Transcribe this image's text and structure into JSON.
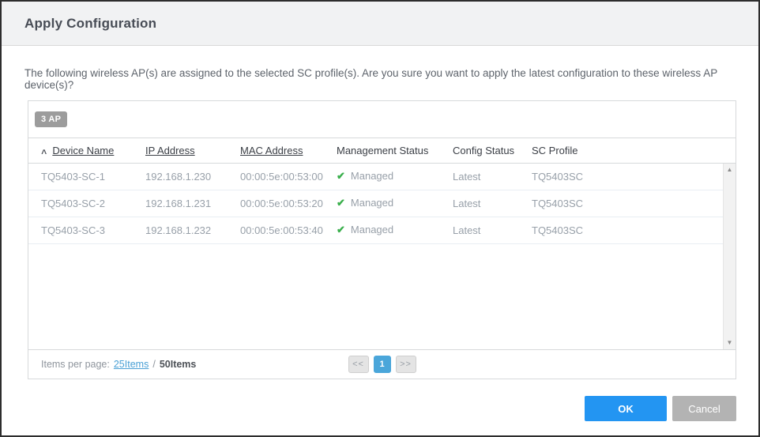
{
  "dialog": {
    "title": "Apply Configuration",
    "description": "The following wireless AP(s) are assigned to the selected SC profile(s). Are you sure you want to apply the latest configuration to these wireless AP device(s)?"
  },
  "icons": {
    "sort_asc": "∧",
    "check": "✔",
    "scroll_up": "▲",
    "scroll_down": "▼"
  },
  "table": {
    "count_badge": "3 AP",
    "columns": [
      {
        "label": "Device Name",
        "sortable": true,
        "sorted": "asc"
      },
      {
        "label": "IP Address",
        "sortable": true
      },
      {
        "label": "MAC Address",
        "sortable": true
      },
      {
        "label": "Management Status",
        "sortable": false
      },
      {
        "label": "Config Status",
        "sortable": false
      },
      {
        "label": "SC Profile",
        "sortable": false
      }
    ],
    "rows": [
      {
        "device_name": "TQ5403-SC-1",
        "ip_address": "192.168.1.230",
        "mac_address": "00:00:5e:00:53:00",
        "management_status": "Managed",
        "config_status": "Latest",
        "sc_profile": "TQ5403SC"
      },
      {
        "device_name": "TQ5403-SC-2",
        "ip_address": "192.168.1.231",
        "mac_address": "00:00:5e:00:53:20",
        "management_status": "Managed",
        "config_status": "Latest",
        "sc_profile": "TQ5403SC"
      },
      {
        "device_name": "TQ5403-SC-3",
        "ip_address": "192.168.1.232",
        "mac_address": "00:00:5e:00:53:40",
        "management_status": "Managed",
        "config_status": "Latest",
        "sc_profile": "TQ5403SC"
      }
    ]
  },
  "pagination": {
    "items_per_page_label": "Items per page:",
    "option_25": "25Items",
    "separator": "/",
    "option_50": "50Items",
    "prev_label": "<<",
    "current_page": "1",
    "next_label": ">>"
  },
  "footer": {
    "ok_label": "OK",
    "cancel_label": "Cancel"
  },
  "colors": {
    "accent_blue": "#2395f2",
    "active_page_blue": "#4aa6da",
    "link_blue": "#4aa0d5",
    "success_green": "#3aaf4c",
    "badge_gray": "#9c9c9c",
    "cancel_gray": "#b3b3b3"
  }
}
